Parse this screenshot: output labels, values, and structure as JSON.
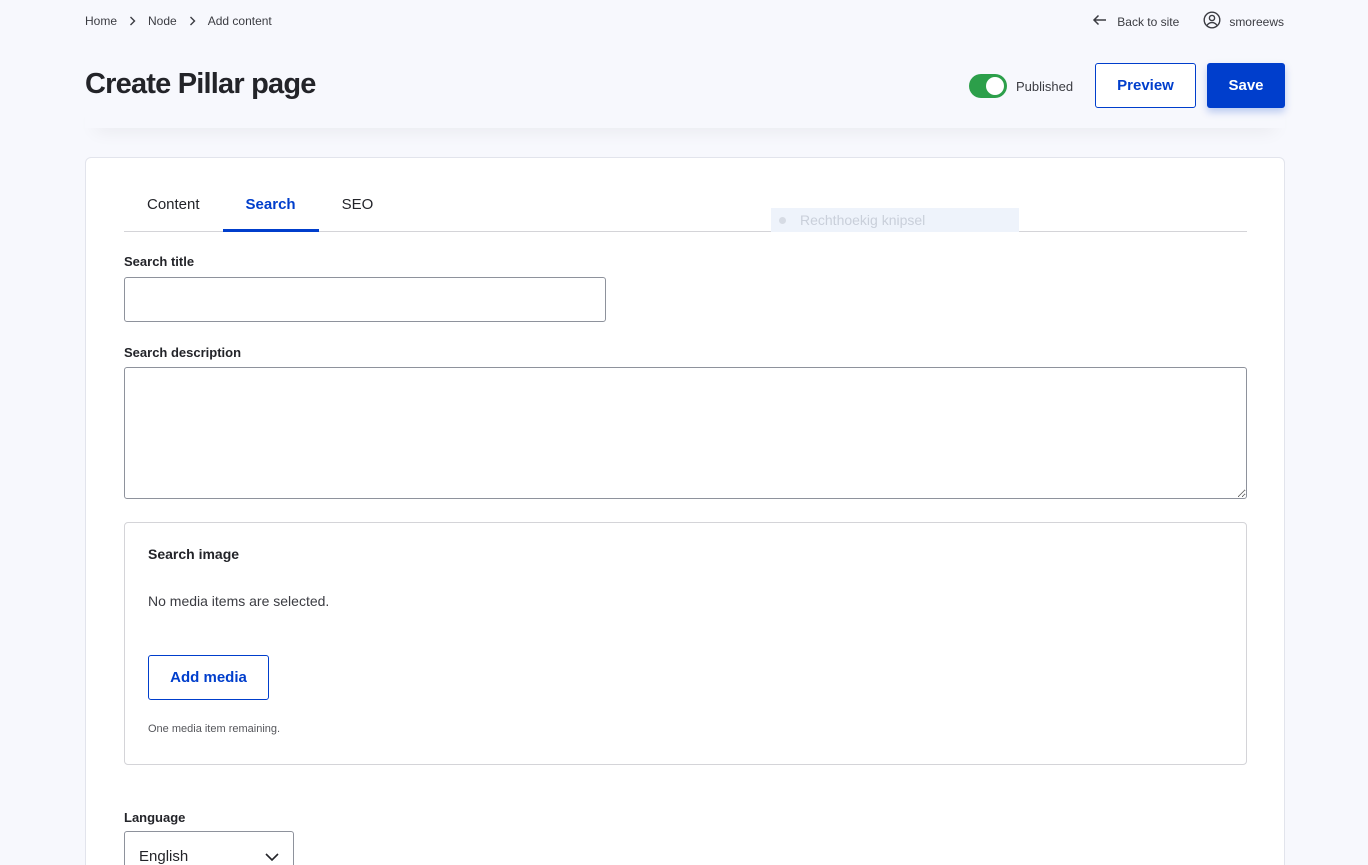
{
  "breadcrumb": {
    "items": [
      "Home",
      "Node",
      "Add content"
    ]
  },
  "toolbar": {
    "back_label": "Back to site",
    "user_name": "smoreews",
    "published_label": "Published",
    "published": true,
    "preview_label": "Preview",
    "save_label": "Save"
  },
  "page": {
    "title": "Create Pillar page"
  },
  "tabs": [
    {
      "label": "Content",
      "active": false
    },
    {
      "label": "Search",
      "active": true
    },
    {
      "label": "SEO",
      "active": false
    }
  ],
  "overlay": {
    "ghost_text": "Rechthoekig knipsel"
  },
  "form": {
    "search_title_label": "Search title",
    "search_title_value": "",
    "search_description_label": "Search description",
    "search_description_value": "",
    "search_image": {
      "title": "Search image",
      "empty_text": "No media items are selected.",
      "add_label": "Add media",
      "help_text": "One media item remaining."
    },
    "language_label": "Language",
    "language_value": "English"
  },
  "colors": {
    "accent": "#003ecc",
    "toggle_on": "#2c9f4a",
    "background": "#f7f8fd"
  },
  "icons": {
    "breadcrumb_separator": "chevron-right-icon",
    "back": "arrow-left-icon",
    "user": "user-circle-icon",
    "select": "chevron-down-icon"
  }
}
